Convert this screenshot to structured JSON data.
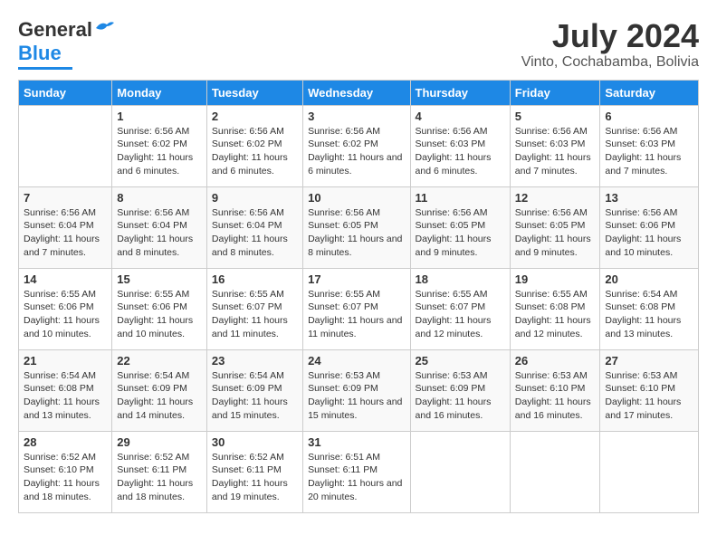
{
  "header": {
    "logo_general": "General",
    "logo_blue": "Blue",
    "month_year": "July 2024",
    "location": "Vinto, Cochabamba, Bolivia"
  },
  "weekdays": [
    "Sunday",
    "Monday",
    "Tuesday",
    "Wednesday",
    "Thursday",
    "Friday",
    "Saturday"
  ],
  "weeks": [
    [
      {
        "day": "",
        "info": ""
      },
      {
        "day": "1",
        "info": "Sunrise: 6:56 AM\nSunset: 6:02 PM\nDaylight: 11 hours and 6 minutes."
      },
      {
        "day": "2",
        "info": "Sunrise: 6:56 AM\nSunset: 6:02 PM\nDaylight: 11 hours and 6 minutes."
      },
      {
        "day": "3",
        "info": "Sunrise: 6:56 AM\nSunset: 6:02 PM\nDaylight: 11 hours and 6 minutes."
      },
      {
        "day": "4",
        "info": "Sunrise: 6:56 AM\nSunset: 6:03 PM\nDaylight: 11 hours and 6 minutes."
      },
      {
        "day": "5",
        "info": "Sunrise: 6:56 AM\nSunset: 6:03 PM\nDaylight: 11 hours and 7 minutes."
      },
      {
        "day": "6",
        "info": "Sunrise: 6:56 AM\nSunset: 6:03 PM\nDaylight: 11 hours and 7 minutes."
      }
    ],
    [
      {
        "day": "7",
        "info": "Sunrise: 6:56 AM\nSunset: 6:04 PM\nDaylight: 11 hours and 7 minutes."
      },
      {
        "day": "8",
        "info": "Sunrise: 6:56 AM\nSunset: 6:04 PM\nDaylight: 11 hours and 8 minutes."
      },
      {
        "day": "9",
        "info": "Sunrise: 6:56 AM\nSunset: 6:04 PM\nDaylight: 11 hours and 8 minutes."
      },
      {
        "day": "10",
        "info": "Sunrise: 6:56 AM\nSunset: 6:05 PM\nDaylight: 11 hours and 8 minutes."
      },
      {
        "day": "11",
        "info": "Sunrise: 6:56 AM\nSunset: 6:05 PM\nDaylight: 11 hours and 9 minutes."
      },
      {
        "day": "12",
        "info": "Sunrise: 6:56 AM\nSunset: 6:05 PM\nDaylight: 11 hours and 9 minutes."
      },
      {
        "day": "13",
        "info": "Sunrise: 6:56 AM\nSunset: 6:06 PM\nDaylight: 11 hours and 10 minutes."
      }
    ],
    [
      {
        "day": "14",
        "info": "Sunrise: 6:55 AM\nSunset: 6:06 PM\nDaylight: 11 hours and 10 minutes."
      },
      {
        "day": "15",
        "info": "Sunrise: 6:55 AM\nSunset: 6:06 PM\nDaylight: 11 hours and 10 minutes."
      },
      {
        "day": "16",
        "info": "Sunrise: 6:55 AM\nSunset: 6:07 PM\nDaylight: 11 hours and 11 minutes."
      },
      {
        "day": "17",
        "info": "Sunrise: 6:55 AM\nSunset: 6:07 PM\nDaylight: 11 hours and 11 minutes."
      },
      {
        "day": "18",
        "info": "Sunrise: 6:55 AM\nSunset: 6:07 PM\nDaylight: 11 hours and 12 minutes."
      },
      {
        "day": "19",
        "info": "Sunrise: 6:55 AM\nSunset: 6:08 PM\nDaylight: 11 hours and 12 minutes."
      },
      {
        "day": "20",
        "info": "Sunrise: 6:54 AM\nSunset: 6:08 PM\nDaylight: 11 hours and 13 minutes."
      }
    ],
    [
      {
        "day": "21",
        "info": "Sunrise: 6:54 AM\nSunset: 6:08 PM\nDaylight: 11 hours and 13 minutes."
      },
      {
        "day": "22",
        "info": "Sunrise: 6:54 AM\nSunset: 6:09 PM\nDaylight: 11 hours and 14 minutes."
      },
      {
        "day": "23",
        "info": "Sunrise: 6:54 AM\nSunset: 6:09 PM\nDaylight: 11 hours and 15 minutes."
      },
      {
        "day": "24",
        "info": "Sunrise: 6:53 AM\nSunset: 6:09 PM\nDaylight: 11 hours and 15 minutes."
      },
      {
        "day": "25",
        "info": "Sunrise: 6:53 AM\nSunset: 6:09 PM\nDaylight: 11 hours and 16 minutes."
      },
      {
        "day": "26",
        "info": "Sunrise: 6:53 AM\nSunset: 6:10 PM\nDaylight: 11 hours and 16 minutes."
      },
      {
        "day": "27",
        "info": "Sunrise: 6:53 AM\nSunset: 6:10 PM\nDaylight: 11 hours and 17 minutes."
      }
    ],
    [
      {
        "day": "28",
        "info": "Sunrise: 6:52 AM\nSunset: 6:10 PM\nDaylight: 11 hours and 18 minutes."
      },
      {
        "day": "29",
        "info": "Sunrise: 6:52 AM\nSunset: 6:11 PM\nDaylight: 11 hours and 18 minutes."
      },
      {
        "day": "30",
        "info": "Sunrise: 6:52 AM\nSunset: 6:11 PM\nDaylight: 11 hours and 19 minutes."
      },
      {
        "day": "31",
        "info": "Sunrise: 6:51 AM\nSunset: 6:11 PM\nDaylight: 11 hours and 20 minutes."
      },
      {
        "day": "",
        "info": ""
      },
      {
        "day": "",
        "info": ""
      },
      {
        "day": "",
        "info": ""
      }
    ]
  ]
}
